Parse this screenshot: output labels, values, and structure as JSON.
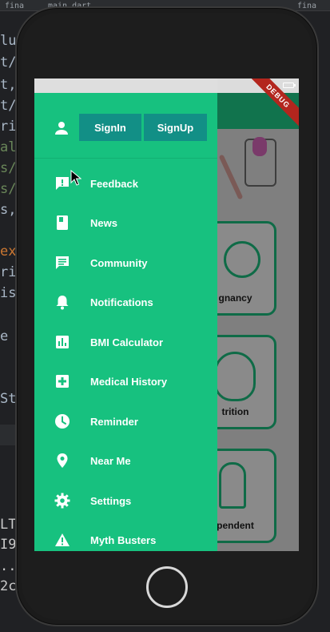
{
  "ide": {
    "tabs": [
      "fina",
      "main.dart",
      "fina"
    ],
    "code_lines": [
      "lu",
      "t/",
      "t,",
      "t/",
      "ri",
      "al",
      "s/",
      "s/",
      "s,",
      "ex",
      "ri",
      "is",
      "e",
      "St"
    ],
    "bottom_lines": [
      "LT",
      "I9",
      "..",
      "2c"
    ]
  },
  "screen": {
    "debug_label": "DEBUG",
    "cards": [
      {
        "label": "gnancy"
      },
      {
        "label": "trition"
      },
      {
        "label": "pendent"
      }
    ]
  },
  "drawer": {
    "header": {
      "signin_label": "SignIn",
      "signup_label": "SignUp"
    },
    "items": [
      {
        "label": "Feedback",
        "icon": "feedback-icon"
      },
      {
        "label": "News",
        "icon": "book-icon"
      },
      {
        "label": "Community",
        "icon": "chat-icon"
      },
      {
        "label": "Notifications",
        "icon": "bell-icon"
      },
      {
        "label": "BMI Calculator",
        "icon": "chart-icon"
      },
      {
        "label": "Medical History",
        "icon": "medical-cross-icon"
      },
      {
        "label": "Reminder",
        "icon": "clock-icon"
      },
      {
        "label": "Near Me",
        "icon": "location-pin-icon"
      },
      {
        "label": "Settings",
        "icon": "gear-icon"
      },
      {
        "label": "Myth Busters",
        "icon": "warning-icon"
      }
    ]
  },
  "colors": {
    "drawer_bg": "#17c17f",
    "auth_button_bg": "#128f86",
    "header_green": "#11734d",
    "debug_ribbon": "#b3261e"
  }
}
